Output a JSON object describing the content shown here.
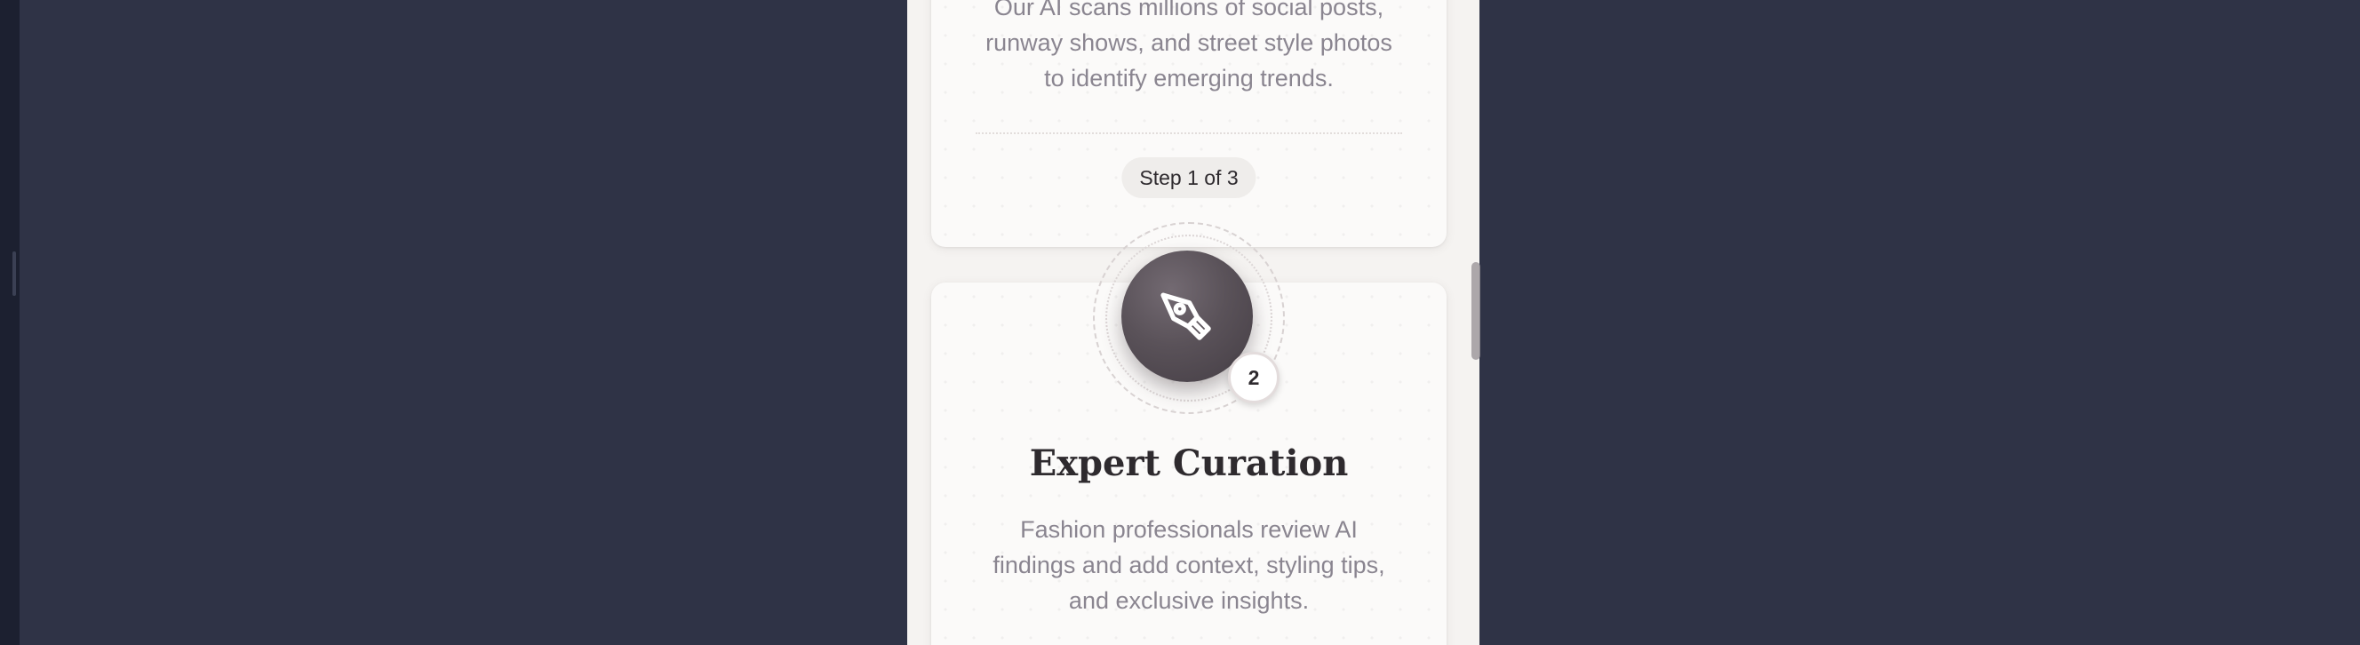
{
  "steps": [
    {
      "description": "Our AI scans millions of social posts, runway shows, and street style photos to identify emerging trends.",
      "step_label": "Step 1 of 3"
    },
    {
      "number": "2",
      "icon": "pen-nib-icon",
      "title": "Expert Curation",
      "description": "Fashion professionals review AI findings and add context, styling tips, and exclusive insights."
    }
  ],
  "colors": {
    "background": "#2f3346",
    "card": "#fbfaf9",
    "icon_circle": "#5a5259",
    "title_text": "#2e2a2e",
    "body_text": "#8a8590"
  }
}
